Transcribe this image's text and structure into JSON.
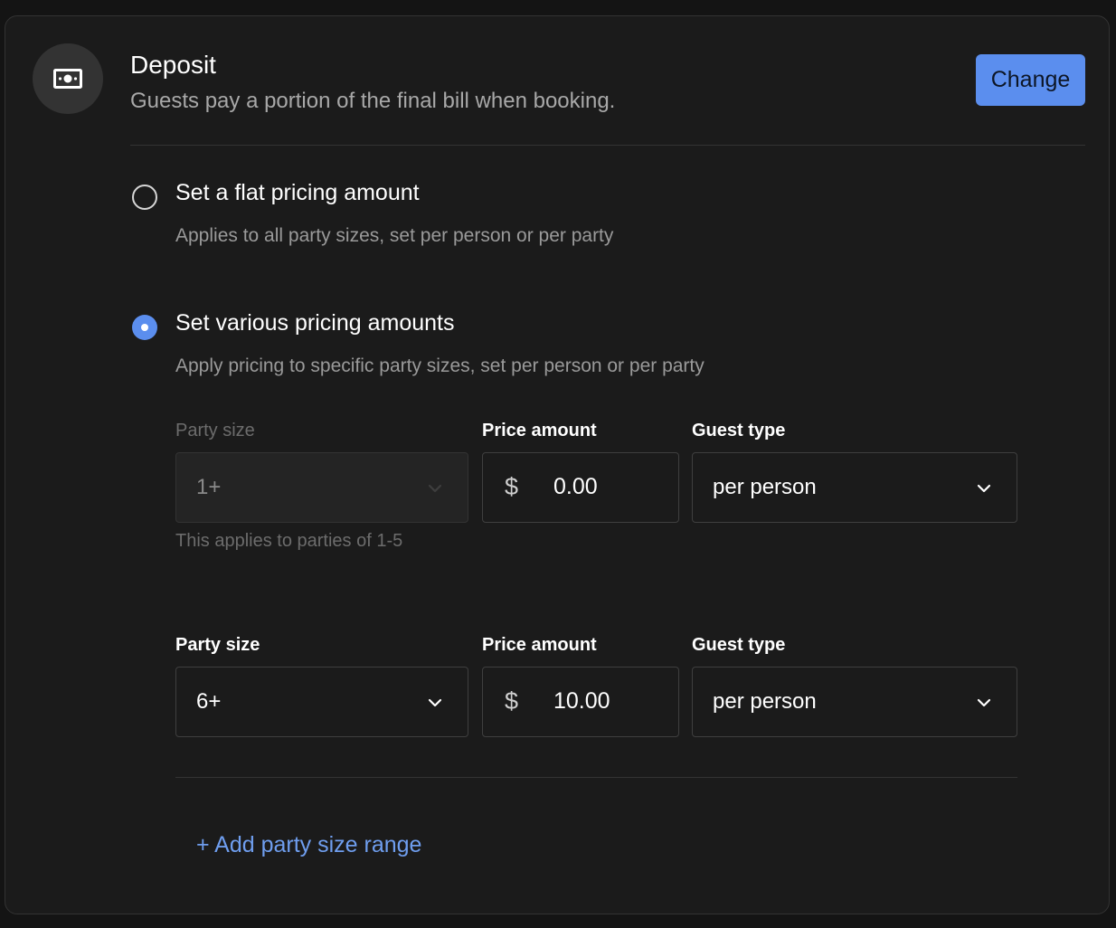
{
  "header": {
    "title": "Deposit",
    "subtitle": "Guests pay a portion of the final bill when booking.",
    "change_label": "Change",
    "icon": "money-bill-icon"
  },
  "options": [
    {
      "label": "Set a flat pricing amount",
      "description": "Applies to all party sizes, set per person or per party",
      "selected": false
    },
    {
      "label": "Set various pricing amounts",
      "description": "Apply pricing to specific party sizes, set per person or per party",
      "selected": true
    }
  ],
  "ranges": [
    {
      "party_size_label": "Party size",
      "price_label": "Price amount",
      "guest_type_label": "Guest type",
      "party_size": "1+",
      "party_size_disabled": true,
      "currency": "$",
      "price": "0.00",
      "guest_type": "per person",
      "helper": "This applies to parties of 1-5"
    },
    {
      "party_size_label": "Party size",
      "price_label": "Price amount",
      "guest_type_label": "Guest type",
      "party_size": "6+",
      "party_size_disabled": false,
      "currency": "$",
      "price": "10.00",
      "guest_type": "per person"
    }
  ],
  "add_range_label": "+ Add party size range",
  "colors": {
    "accent": "#5b8eee",
    "link": "#6f9eef",
    "background": "#1b1b1b"
  }
}
